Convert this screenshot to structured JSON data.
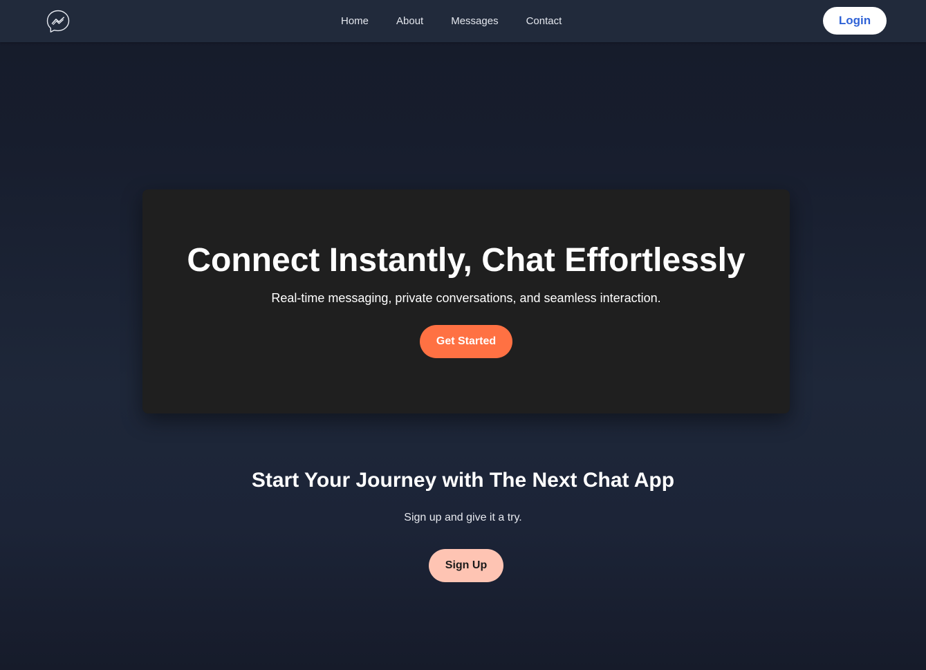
{
  "header": {
    "logo_icon": "messenger-chat-icon",
    "nav": [
      "Home",
      "About",
      "Messages",
      "Contact"
    ],
    "login_label": "Login"
  },
  "hero": {
    "title": "Connect Instantly, Chat Effortlessly",
    "subtitle": "Real-time messaging, private conversations, and seamless interaction.",
    "cta_label": "Get Started"
  },
  "journey": {
    "title": "Start Your Journey with The Next Chat App",
    "subtitle": "Sign up and give it a try.",
    "cta_label": "Sign Up"
  },
  "colors": {
    "background": "#161b2a",
    "navbar": "#212a3b",
    "card": "#1f1f1f",
    "primary_cta": "#ff7143",
    "secondary_cta": "#fec4b3",
    "login_text": "#2f62d6"
  }
}
